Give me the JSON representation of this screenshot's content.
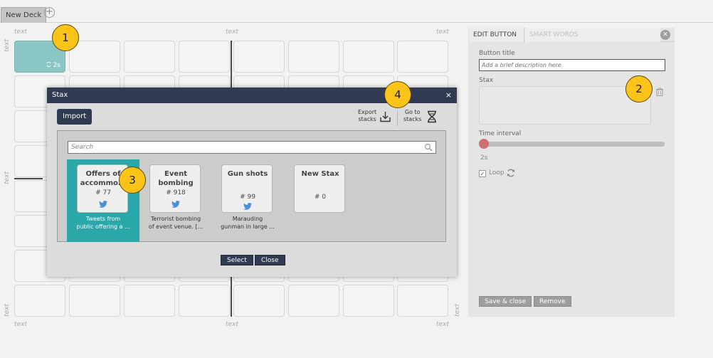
{
  "tabbar": {
    "deck_name": "New Deck",
    "add_icon": "plus-circle-icon",
    "add_symbol": "+"
  },
  "grid": {
    "placeholder": "text",
    "active_counter": "2s",
    "counter_icon": "refresh-icon"
  },
  "markers": [
    "1",
    "2",
    "3",
    "4"
  ],
  "panel": {
    "tabs": [
      "EDIT BUTTON",
      "SMART WORDS"
    ],
    "close_icon": "close-circle-icon",
    "close_symbol": "✕",
    "button_title_label": "Button title",
    "button_title_placeholder": "Add a brief description here",
    "stax_label": "Stax",
    "trash_icon": "trash-icon",
    "time_interval_label": "Time interval",
    "time_interval_value": "2s",
    "time_interval_fraction": 0.0,
    "loop_label": "Loop",
    "loop_checked": true,
    "loop_check_symbol": "✓",
    "loop_icon": "refresh-icon",
    "save_label": "Save & close",
    "remove_label": "Remove"
  },
  "modal": {
    "title": "Stax",
    "close_symbol": "×",
    "import_label": "Import",
    "export_label_1": "Export",
    "export_label_2": "stacks",
    "export_icon": "download-icon",
    "goto_label_1": "Go to",
    "goto_label_2": "stacks",
    "goto_icon": "dna-icon",
    "search_placeholder": "Search",
    "search_icon": "search-icon",
    "stacks": [
      {
        "title_1": "Offers of",
        "title_2": "accommo...",
        "count": "# 77",
        "has_twitter": true,
        "desc_1": "Tweets from",
        "desc_2": "public offering a ...",
        "selected": true
      },
      {
        "title_1": "Event",
        "title_2": "bombing",
        "count": "# 918",
        "has_twitter": true,
        "desc_1": "Terrorist bombing",
        "desc_2": "of event venue. [...",
        "selected": false
      },
      {
        "title_1": "Gun shots",
        "title_2": "",
        "count": "# 99",
        "has_twitter": true,
        "desc_1": "Marauding",
        "desc_2": "gunman in large ...",
        "selected": false
      },
      {
        "title_1": "New Stax",
        "title_2": "",
        "count": "# 0",
        "has_twitter": false,
        "desc_1": "",
        "desc_2": "",
        "selected": false
      }
    ],
    "select_label": "Select",
    "close_label": "Close"
  }
}
